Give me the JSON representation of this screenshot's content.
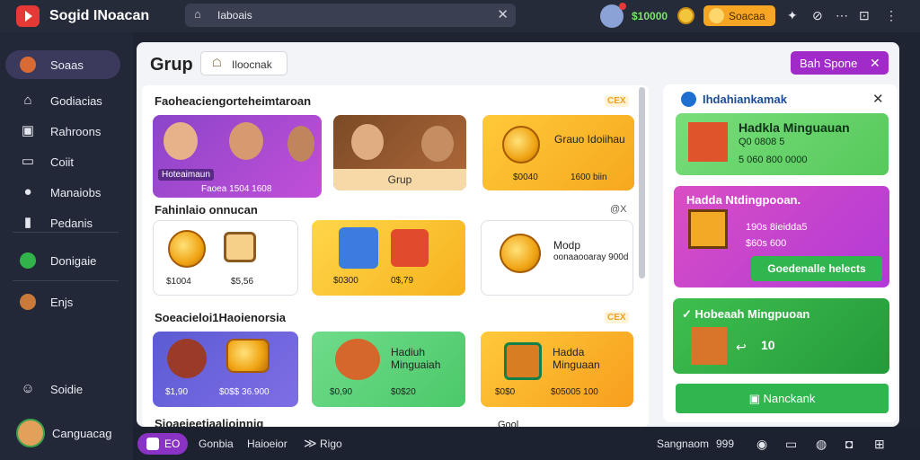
{
  "app": {
    "title": "Sogid INoacan"
  },
  "search": {
    "value": "Iaboais"
  },
  "topbar": {
    "coins": "$10000",
    "badge_label": "Soacaa"
  },
  "sidebar": {
    "items": [
      {
        "label": "Soaas"
      },
      {
        "label": "Godiacias"
      },
      {
        "label": "Rahroons"
      },
      {
        "label": "Coiit"
      },
      {
        "label": "Manaiobs"
      },
      {
        "label": "Pedanis"
      },
      {
        "label": "Donigaie"
      },
      {
        "label": "Enjs"
      },
      {
        "label": "Soidie"
      }
    ],
    "user_label": "Canguacag"
  },
  "main": {
    "title": "Grup",
    "filter_label": "Iloocnak",
    "top_button_label": "Bah Spone"
  },
  "sections": [
    {
      "title": "Faoheaciengorteheimtaroan",
      "tag": "CEX",
      "cards": [
        {
          "title": "Hoteaimaun",
          "meta": "Faoea 1504 1608"
        },
        {
          "title": "Grup"
        },
        {
          "title": "Grauo Idoiihau",
          "price1": "$0040",
          "price2": "1600 biin"
        }
      ]
    },
    {
      "title": "Fahinlaio onnucan",
      "control": "@X",
      "cards": [
        {
          "price1": "$1004",
          "price2": "$5,56"
        },
        {
          "price1": "$0300",
          "price2": "0$,79"
        },
        {
          "title": "Modp",
          "subtitle": "oonaaooaray 900d"
        }
      ]
    },
    {
      "title": "Soeacieloi1Haoienorsia",
      "tag": "CEX",
      "cards": [
        {
          "price1": "$1,90",
          "price2": "$0$$ 36.900"
        },
        {
          "title": "Hadiuh Minguaiah",
          "price1": "$0,90",
          "price2": "$0$20"
        },
        {
          "title": "Hadda Minguaan",
          "price1": "$0$0",
          "price2": "$05005 100"
        }
      ]
    }
  ],
  "fourth_row_title": "Sioaeieetiaalioinniq",
  "fourth_row_right": "Gool",
  "right_panel": {
    "title": "Ihdahiankamak",
    "cards": [
      {
        "title": "Hadkla Minguauan",
        "subtitle": "Q0 0808 5",
        "meta": "5 060 800 0000"
      },
      {
        "title": "Hadda Ntdingpooan.",
        "line1": "190s 8ieidda5",
        "line2": "$60s 600",
        "button": "Goedenalle helects"
      },
      {
        "title": "Hobeaah Mingpuoan",
        "value": "10",
        "check": "✓"
      }
    ],
    "bottom_button": "Nanckank"
  },
  "bottombar": {
    "chip_label": "EO",
    "items": [
      "Gonbia",
      "Haioeior",
      "Rigo"
    ],
    "right_label": "Sangnaom",
    "right_value": "999"
  }
}
